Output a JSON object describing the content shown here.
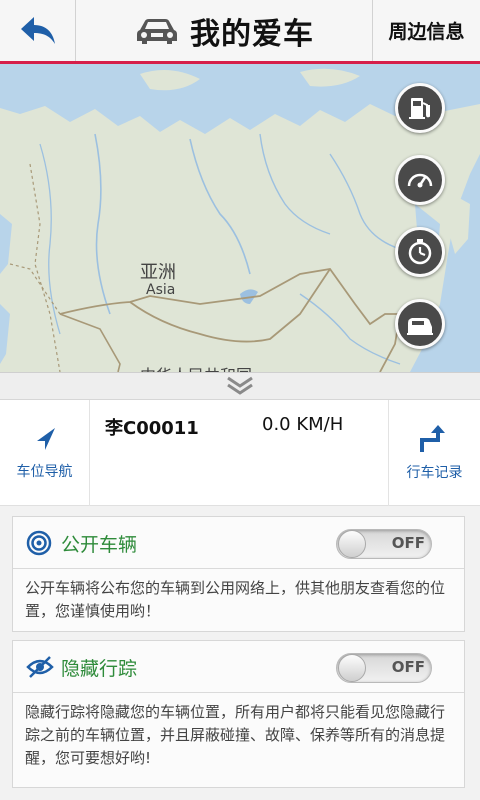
{
  "header": {
    "title": "我的爱车",
    "nearby_label": "周边信息"
  },
  "map": {
    "label_cn": "亚洲",
    "label_en": "Asia",
    "label_partial": "中华人民共和国"
  },
  "info": {
    "nav_label": "车位导航",
    "record_label": "行车记录",
    "plate": "李C00011",
    "speed": "0.0 KM/H"
  },
  "public_card": {
    "title": "公开车辆",
    "toggle_state": "OFF",
    "description": "公开车辆将公布您的车辆到公用网络上，供其他朋友查看您的位置，您谨慎使用哟！"
  },
  "hide_card": {
    "title": "隐藏行踪",
    "toggle_state": "OFF",
    "description": "隐藏行踪将隐藏您的车辆位置，所有用户都将只能看见您隐藏行踪之前的车辆位置，并且屏蔽碰撞、故障、保养等所有的消息提醒，您可要想好哟!"
  },
  "colors": {
    "accent": "#d61f4a",
    "link_blue": "#1f5fa8",
    "green": "#2e8b3a",
    "water": "#b8d4ea",
    "land": "#dfe5d6"
  }
}
